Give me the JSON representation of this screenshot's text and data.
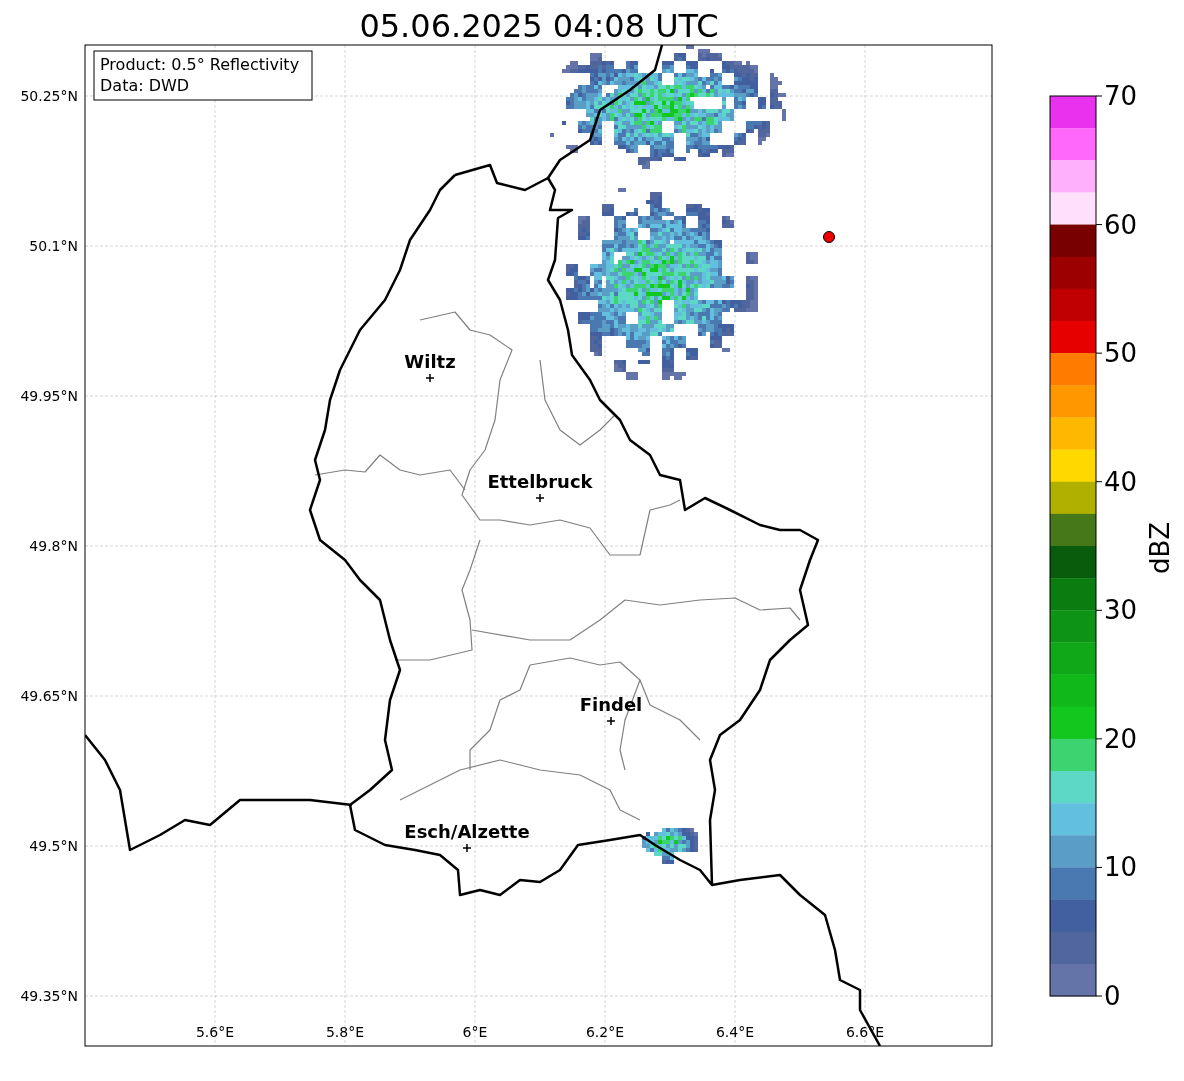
{
  "title": "05.06.2025 04:08 UTC",
  "legend": [
    "Product: 0.5° Reflectivity",
    "Data: DWD"
  ],
  "lat_ticks": [
    "50.25°N",
    "50.1°N",
    "49.95°N",
    "49.8°N",
    "49.65°N",
    "49.5°N",
    "49.35°N"
  ],
  "lon_ticks": [
    "5.6°E",
    "5.8°E",
    "6°E",
    "6.2°E",
    "6.4°E",
    "6.6°E"
  ],
  "cities": [
    "Wiltz",
    "Ettelbruck",
    "Findel",
    "Esch/Alzette"
  ],
  "colorbar": {
    "label": "dBZ",
    "ticks": [
      "70",
      "60",
      "50",
      "40",
      "30",
      "20",
      "10",
      "0"
    ],
    "segments": [
      {
        "color": "#e832ee"
      },
      {
        "color": "#ff68fa"
      },
      {
        "color": "#ffb0fc"
      },
      {
        "color": "#ffe0fc"
      },
      {
        "color": "#780000"
      },
      {
        "color": "#9c0000"
      },
      {
        "color": "#c00000"
      },
      {
        "color": "#e60000"
      },
      {
        "color": "#ff7c00"
      },
      {
        "color": "#ff9800"
      },
      {
        "color": "#ffb800"
      },
      {
        "color": "#ffd800"
      },
      {
        "color": "#b0b000"
      },
      {
        "color": "#46781a"
      },
      {
        "color": "#085c0c"
      },
      {
        "color": "#0a7c10"
      },
      {
        "color": "#0e9414"
      },
      {
        "color": "#10a818"
      },
      {
        "color": "#10b81a"
      },
      {
        "color": "#12c81e"
      },
      {
        "color": "#3cd470"
      },
      {
        "color": "#5ed8c6"
      },
      {
        "color": "#62c0de"
      },
      {
        "color": "#5a9ec8"
      },
      {
        "color": "#4a78b0"
      },
      {
        "color": "#42609f"
      },
      {
        "color": "#50669c"
      },
      {
        "color": "#6474a8"
      }
    ]
  }
}
